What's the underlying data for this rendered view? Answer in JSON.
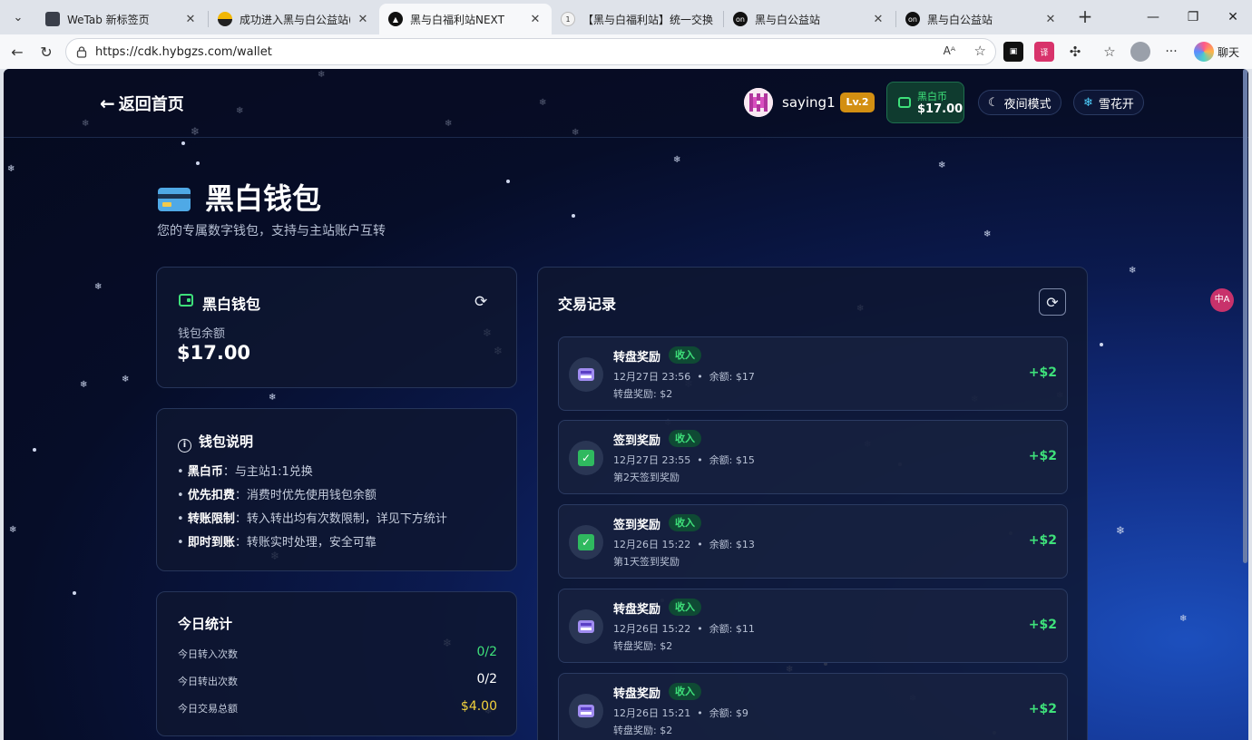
{
  "browser": {
    "tabs": [
      {
        "title": "WeTab 新标签页"
      },
      {
        "title": "成功进入黑与白公益站(非站"
      },
      {
        "title": "黑与白福利站NEXT"
      },
      {
        "title": "【黑与白福利站】统一交换"
      },
      {
        "title": "黑与白公益站"
      },
      {
        "title": "黑与白公益站"
      }
    ],
    "url": "https://cdk.hybgzs.com/wallet",
    "chat_label": "聊天",
    "read_aloud": "A"
  },
  "header": {
    "back_label": "返回首页",
    "username": "saying1",
    "level": "Lv.2",
    "coin_label": "黑白币",
    "coin_value": "$17.00",
    "night_mode": "夜间模式",
    "snow_toggle": "雪花开"
  },
  "page": {
    "title": "黑白钱包",
    "subtitle": "您的专属数字钱包，支持与主站账户互转"
  },
  "wallet_card": {
    "title": "黑白钱包",
    "balance_label": "钱包余额",
    "balance_value": "$17.00"
  },
  "info_card": {
    "title": "钱包说明",
    "rules": [
      {
        "key": "黑白币",
        "text": "：与主站1:1兑换"
      },
      {
        "key": "优先扣费",
        "text": "：消费时优先使用钱包余额"
      },
      {
        "key": "转账限制",
        "text": "：转入转出均有次数限制，详见下方统计"
      },
      {
        "key": "即时到账",
        "text": "：转账实时处理，安全可靠"
      }
    ]
  },
  "stats_card": {
    "title": "今日统计",
    "rows": [
      {
        "label": "今日转入次数",
        "value": "0/2",
        "color": "#3ee07a"
      },
      {
        "label": "今日转出次数",
        "value": "0/2",
        "color": "#ffffff"
      },
      {
        "label": "今日交易总额",
        "value": "$4.00",
        "color": "#f2d23c"
      }
    ]
  },
  "transactions": {
    "title": "交易记录",
    "items": [
      {
        "name": "转盘奖励",
        "tag": "收入",
        "time": "12月27日 23:56",
        "balance": "余额: $17",
        "desc": "转盘奖励: $2",
        "amount": "+$2",
        "icon": "wheel-icon"
      },
      {
        "name": "签到奖励",
        "tag": "收入",
        "time": "12月27日 23:55",
        "balance": "余额: $15",
        "desc": "第2天签到奖励",
        "amount": "+$2",
        "icon": "checkin-icon"
      },
      {
        "name": "签到奖励",
        "tag": "收入",
        "time": "12月26日 15:22",
        "balance": "余额: $13",
        "desc": "第1天签到奖励",
        "amount": "+$2",
        "icon": "checkin-icon"
      },
      {
        "name": "转盘奖励",
        "tag": "收入",
        "time": "12月26日 15:22",
        "balance": "余额: $11",
        "desc": "转盘奖励: $2",
        "amount": "+$2",
        "icon": "wheel-icon"
      },
      {
        "name": "转盘奖励",
        "tag": "收入",
        "time": "12月26日 15:21",
        "balance": "余额: $9",
        "desc": "转盘奖励: $2",
        "amount": "+$2",
        "icon": "wheel-icon"
      }
    ]
  },
  "colors": {
    "accent_green": "#3ee07a",
    "level_badge": "#d38f12",
    "total_yellow": "#f2d23c"
  }
}
